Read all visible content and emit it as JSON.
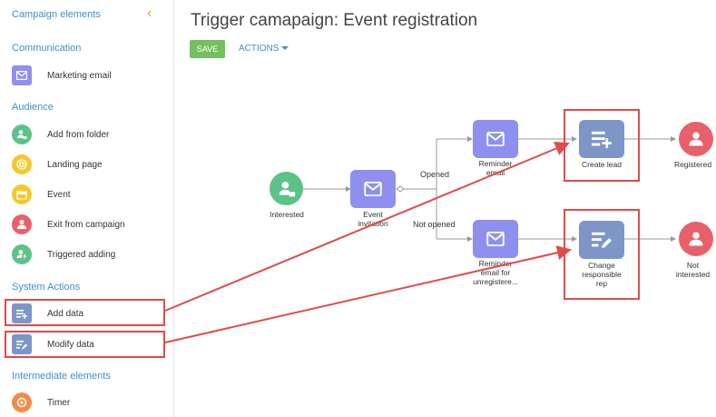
{
  "sidebar": {
    "title": "Campaign elements",
    "collapse_icon": "chevron-left-icon",
    "sections": {
      "communication": "Communication",
      "audience": "Audience",
      "system_actions": "System Actions",
      "intermediate": "Intermediate elements"
    },
    "items": {
      "marketing_email": "Marketing email",
      "add_from_folder": "Add from folder",
      "landing_page": "Landing page",
      "event": "Event",
      "exit_from_campaign": "Exit from campaign",
      "triggered_adding": "Triggered adding",
      "add_data": "Add data",
      "modify_data": "Modify data",
      "timer": "Timer"
    }
  },
  "header": {
    "title": "Trigger camapaign: Event registration",
    "save_label": "SAVE",
    "actions_label": "ACTIONS"
  },
  "canvas": {
    "nodes": {
      "interested": "Interested",
      "event_invitation_1": "Event",
      "event_invitation_2": "invitation",
      "reminder_email_1": "Reminder",
      "reminder_email_2": "email",
      "reminder_unreg_1": "Reminder",
      "reminder_unreg_2": "email for",
      "reminder_unreg_3": "unregistere...",
      "create_lead": "Create lead",
      "change_rep_1": "Change",
      "change_rep_2": "responsible",
      "change_rep_3": "rep",
      "registered": "Registered",
      "not_interested_1": "Not",
      "not_interested_2": "interested"
    },
    "edges": {
      "opened": "Opened",
      "not_opened": "Not opened"
    }
  },
  "colors": {
    "accent_blue": "#3d8fd1",
    "save_green": "#74c05c",
    "email_purple": "#8f8ff0",
    "action_slate": "#7e96c7",
    "audience_green": "#5bc288",
    "landing_yellow": "#f5c828",
    "exit_red": "#e8616a",
    "timer_orange": "#f5894a",
    "highlight_red": "#e04b4b"
  }
}
